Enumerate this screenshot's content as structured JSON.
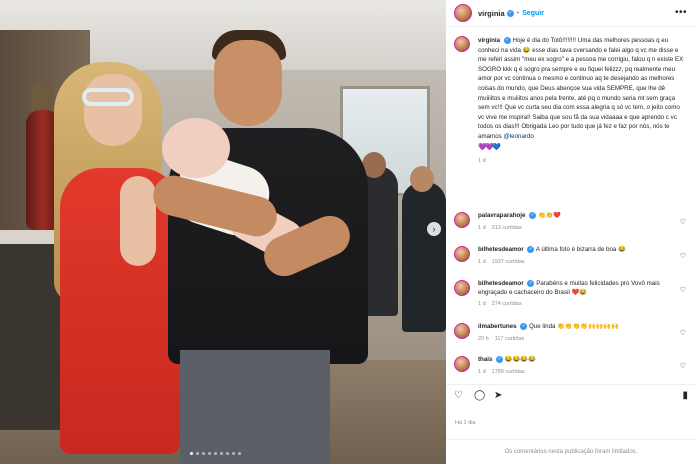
{
  "header": {
    "username": "virginia",
    "separator": "•",
    "follow_label": "Seguir",
    "more_icon": "more-horizontal-icon"
  },
  "caption": {
    "username": "virginia",
    "text": "Hoje é dia do Totô!!!!!!!! Uma das melhores pessoas q eu conheci na vida 😂 esse dias tava cversando e falei algo q vc me disse e me referi assim \"meu ex sogro\" e a pessoa me corrigiu, falou q n existe EX SOGRO kkk q é sogro pra sempre e eu fiquei felizzz, pq realmente meu amor por vc continua o mesmo e continuo aq te desejando as melhores coisas do mundo, que Deus abençoe sua vida SEMPRE, que lhe dê muiiiitos e muiiitos anos pela frente, até pq o mundo seria mt sem graça sem vc!!! Que vc curta seu dia com essa alegria q só vc tem, o jeito como vc vive me inspira!! Saiba que sou fã da sua vidaaaa e que aprendo c vc todos os dias!!! Obrigada Leo por tudo que já fez e faz por nós, nós te amamos",
    "mention": "@leonardo",
    "hearts": [
      "💜",
      "💜",
      "💙"
    ],
    "time": "1 d"
  },
  "comments": [
    {
      "username": "palavraparahoje",
      "verified": true,
      "text": "👏👏❤️",
      "time": "1 d",
      "likes": "313 curtidas"
    },
    {
      "username": "bilhetesdeamor",
      "verified": true,
      "text": "A última foto é bizarra de boa 😂",
      "time": "1 d",
      "likes": "1937 curtidas"
    },
    {
      "username": "bilhetesdeamor",
      "verified": true,
      "text": "Parabéns e muitas felicidades pro Vovô mais engraçado e cachaceiro do Brasil ❤️😂",
      "time": "1 d",
      "likes": "274 curtidas"
    },
    {
      "username": "ilmabertunes",
      "verified": true,
      "text": "Que linda 👏👏👏👏🙌🙌🙌🙌",
      "time": "20 h",
      "likes": "117 curtidas"
    },
    {
      "username": "thais",
      "verified": true,
      "text": "😂😂😂😂",
      "time": "1 d",
      "likes": "1789 curtidas"
    }
  ],
  "actions": {
    "like_icon": "heart-icon",
    "comment_icon": "comment-icon",
    "share_icon": "send-icon",
    "save_icon": "bookmark-icon"
  },
  "date": "Há 1 dia",
  "footer_text": "Os comentários nesta publicação foram limitados.",
  "carousel": {
    "slide_count": 9,
    "active_index": 0
  },
  "colors": {
    "link": "#0095f6",
    "verified": "#3897f0",
    "meta": "#8e8e8e"
  }
}
